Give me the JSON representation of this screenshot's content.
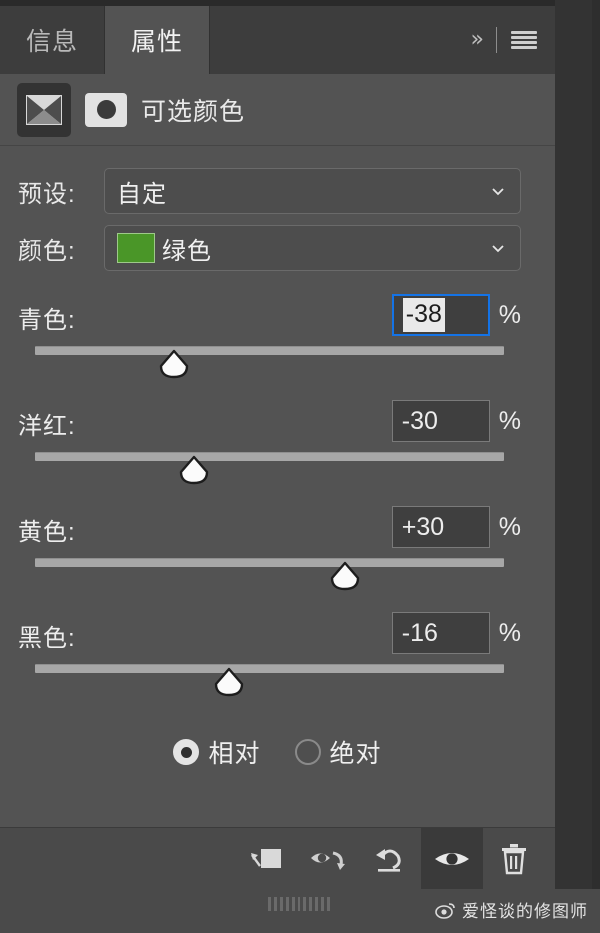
{
  "window": {
    "tabs": [
      {
        "label": "信息",
        "name": "tab-info",
        "active": false
      },
      {
        "label": "属性",
        "name": "tab-properties",
        "active": true
      }
    ],
    "collapse_icon": "»",
    "menu_icon": "hamburger-menu-icon"
  },
  "header": {
    "title": "可选颜色",
    "adjustment_icon": "selective-color-adjustment-icon",
    "mask_icon": "layer-mask-thumbnail-icon"
  },
  "preset": {
    "label": "预设:",
    "value": "自定",
    "chevron": "chevron-down-icon"
  },
  "colors": {
    "label": "颜色:",
    "value": "绿色",
    "swatch_hex": "#4a9628",
    "chevron": "chevron-down-icon"
  },
  "sliders": [
    {
      "name": "cyan",
      "label": "青色:",
      "value": "-38",
      "percent": "%",
      "position_pct": 31.0,
      "focused": true
    },
    {
      "name": "magenta",
      "label": "洋红:",
      "value": "-30",
      "percent": "%",
      "position_pct": 35.0,
      "focused": false
    },
    {
      "name": "yellow",
      "label": "黄色:",
      "value": "+30",
      "percent": "%",
      "position_pct": 65.0,
      "focused": false
    },
    {
      "name": "black",
      "label": "黑色:",
      "value": "-16",
      "percent": "%",
      "position_pct": 42.0,
      "focused": false
    }
  ],
  "method": {
    "options": [
      {
        "label": "相对",
        "name": "radio-relative",
        "selected": true
      },
      {
        "label": "绝对",
        "name": "radio-absolute",
        "selected": false
      }
    ]
  },
  "toolbar": {
    "buttons": [
      {
        "name": "clip-to-layer-icon",
        "active": false
      },
      {
        "name": "toggle-preview-icon",
        "active": false
      },
      {
        "name": "reset-icon",
        "active": false
      },
      {
        "name": "visibility-eye-icon",
        "active": true
      },
      {
        "name": "delete-trash-icon",
        "active": false
      }
    ]
  },
  "footer": {
    "grip": "resize-grip-handle",
    "watermark_text": "爱怪谈的修图师",
    "watermark_logo": "weibo-logo-icon"
  },
  "theme": {
    "panel_bg": "#535353",
    "tabbar_bg": "#3d3d3d",
    "focus_blue": "#1473e6",
    "track_gray": "#a7a7a7"
  }
}
